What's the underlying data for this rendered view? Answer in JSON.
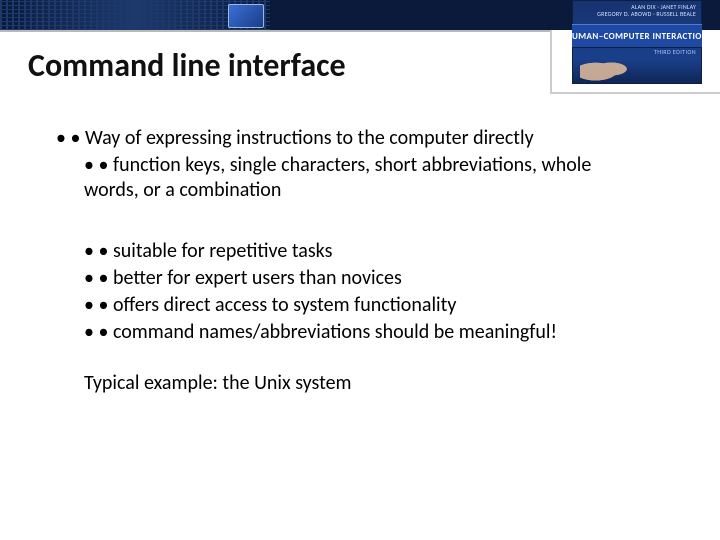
{
  "banner": {
    "book": {
      "authors_line1": "ALAN DIX · JANET FINLAY",
      "authors_line2": "GREGORY D. ABOWD · RUSSELL BEALE",
      "title": "HUMAN–COMPUTER",
      "subtitle": "INTERACTION",
      "edition": "THIRD EDITION"
    }
  },
  "slide": {
    "title": "Command line interface",
    "b1": "Way of expressing instructions to the computer directly",
    "b1a": "function keys, single characters, short abbreviations, whole words, or a combination",
    "b2": "suitable for repetitive tasks",
    "b3": "better for expert users than novices",
    "b4": "offers direct access to system functionality",
    "b5": "command names/abbreviations should  be meaningful!",
    "footer": "Typical example: the Unix system"
  }
}
